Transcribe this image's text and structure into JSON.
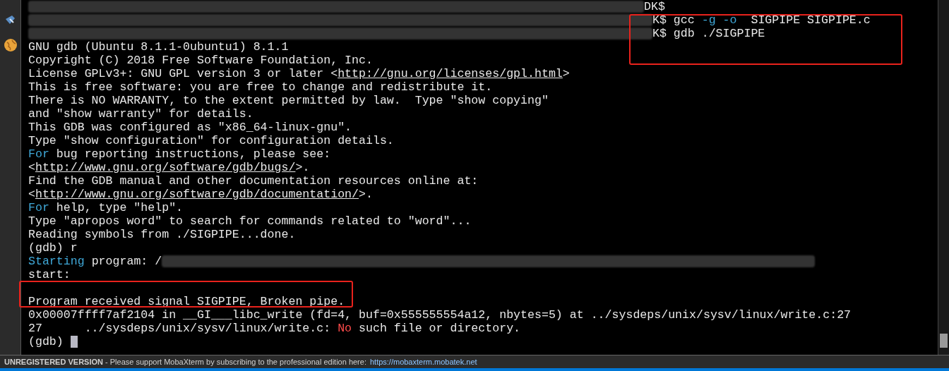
{
  "terminal": {
    "lines": [
      [
        {
          "kind": "redact_short"
        },
        {
          "kind": "plain",
          "text": "DK$"
        }
      ],
      [
        {
          "kind": "redact_mid"
        },
        {
          "kind": "plain",
          "text": "K$ gcc "
        },
        {
          "kind": "cyan",
          "text": "-g -o"
        },
        {
          "kind": "plain",
          "text": "  SIGPIPE SIGPIPE.c"
        }
      ],
      [
        {
          "kind": "redact_mid"
        },
        {
          "kind": "plain",
          "text": "K$ gdb ./SIGPIPE"
        }
      ],
      [
        {
          "kind": "plain",
          "text": "GNU gdb (Ubuntu 8.1.1-0ubuntu1) 8.1.1"
        }
      ],
      [
        {
          "kind": "plain",
          "text": "Copyright (C) 2018 Free Software Foundation, Inc."
        }
      ],
      [
        {
          "kind": "plain",
          "text": "License GPLv3+: GNU GPL version 3 or later <"
        },
        {
          "kind": "link",
          "text": "http://gnu.org/licenses/gpl.html"
        },
        {
          "kind": "plain",
          "text": ">"
        }
      ],
      [
        {
          "kind": "plain",
          "text": "This is free software: you are free to change and redistribute it."
        }
      ],
      [
        {
          "kind": "plain",
          "text": "There is NO WARRANTY, to the extent permitted by law.  Type \"show copying\""
        }
      ],
      [
        {
          "kind": "plain",
          "text": "and \"show warranty\" for details."
        }
      ],
      [
        {
          "kind": "plain",
          "text": "This GDB was configured as \"x86_64-linux-gnu\"."
        }
      ],
      [
        {
          "kind": "plain",
          "text": "Type \"show configuration\" for configuration details."
        }
      ],
      [
        {
          "kind": "cyan",
          "text": "For"
        },
        {
          "kind": "plain",
          "text": " bug reporting instructions, please see:"
        }
      ],
      [
        {
          "kind": "plain",
          "text": "<"
        },
        {
          "kind": "link",
          "text": "http://www.gnu.org/software/gdb/bugs/"
        },
        {
          "kind": "plain",
          "text": ">."
        }
      ],
      [
        {
          "kind": "plain",
          "text": "Find the GDB manual and other documentation resources online at:"
        }
      ],
      [
        {
          "kind": "plain",
          "text": "<"
        },
        {
          "kind": "link",
          "text": "http://www.gnu.org/software/gdb/documentation/"
        },
        {
          "kind": "plain",
          "text": ">."
        }
      ],
      [
        {
          "kind": "cyan",
          "text": "For"
        },
        {
          "kind": "plain",
          "text": " help, type \"help\"."
        }
      ],
      [
        {
          "kind": "plain",
          "text": "Type \"apropos word\" to search for commands related to \"word\"..."
        }
      ],
      [
        {
          "kind": "plain",
          "text": "Reading symbols from ./SIGPIPE...done."
        }
      ],
      [
        {
          "kind": "plain",
          "text": "(gdb) r"
        }
      ],
      [
        {
          "kind": "cyan",
          "text": "Starting"
        },
        {
          "kind": "plain",
          "text": " program: /"
        },
        {
          "kind": "redact_long"
        }
      ],
      [
        {
          "kind": "plain",
          "text": "start:"
        },
        {
          "kind": "newline"
        }
      ],
      [
        {
          "kind": "plain",
          "text": "Program received signal SIGPIPE, Broken pipe."
        }
      ],
      [
        {
          "kind": "plain",
          "text": "0x00007ffff7af2104 in __GI___libc_write (fd=4, buf=0x555555554a12, nbytes=5) at ../sysdeps/unix/sysv/linux/write.c:27"
        }
      ],
      [
        {
          "kind": "plain",
          "text": "27      ../sysdeps/unix/sysv/linux/write.c: "
        },
        {
          "kind": "red",
          "text": "No"
        },
        {
          "kind": "plain",
          "text": " such file or directory."
        }
      ],
      [
        {
          "kind": "plain",
          "text": "(gdb) "
        },
        {
          "kind": "cursor"
        }
      ]
    ]
  },
  "status_bar": {
    "label": "UNREGISTERED VERSION",
    "message": " - Please support MobaXterm by subscribing to the professional edition here:",
    "link": "https://mobaxterm.mobatek.net"
  }
}
